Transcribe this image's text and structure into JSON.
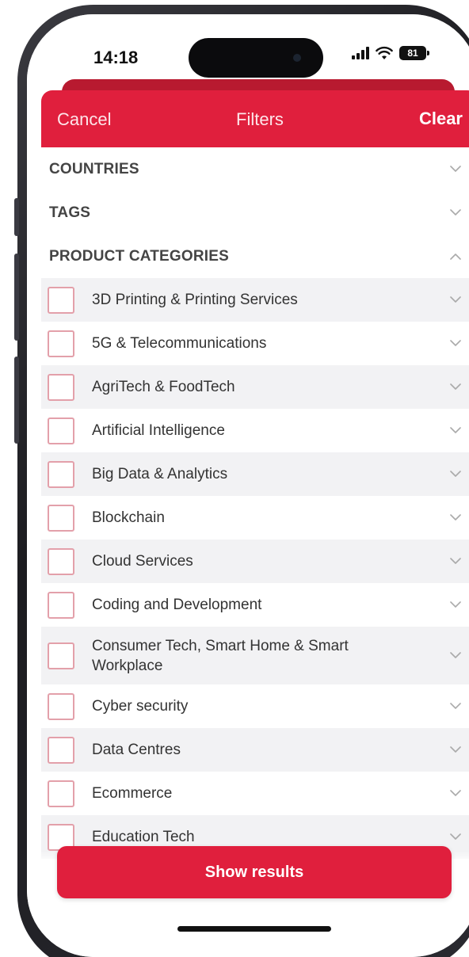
{
  "status_bar": {
    "time": "14:18",
    "battery": "81",
    "icons": [
      "signal-icon",
      "wifi-icon",
      "battery-icon"
    ]
  },
  "header": {
    "cancel_label": "Cancel",
    "title": "Filters",
    "clear_label": "Clear"
  },
  "sections": [
    {
      "label": "COUNTRIES",
      "expanded": false
    },
    {
      "label": "TAGS",
      "expanded": false
    },
    {
      "label": "PRODUCT CATEGORIES",
      "expanded": true
    }
  ],
  "categories": [
    {
      "label": "3D Printing & Printing Services",
      "checked": false
    },
    {
      "label": "5G & Telecommunications",
      "checked": false
    },
    {
      "label": "AgriTech & FoodTech",
      "checked": false
    },
    {
      "label": "Artificial Intelligence",
      "checked": false
    },
    {
      "label": "Big Data & Analytics",
      "checked": false
    },
    {
      "label": "Blockchain",
      "checked": false
    },
    {
      "label": "Cloud Services",
      "checked": false
    },
    {
      "label": "Coding and Development",
      "checked": false
    },
    {
      "label": "Consumer Tech, Smart Home & Smart Workplace",
      "checked": false
    },
    {
      "label": "Cyber security",
      "checked": false
    },
    {
      "label": "Data Centres",
      "checked": false
    },
    {
      "label": "Ecommerce",
      "checked": false
    },
    {
      "label": "Education Tech",
      "checked": false
    }
  ],
  "footer": {
    "show_results_label": "Show results"
  },
  "colors": {
    "accent": "#e01f3d",
    "row_shade": "#f2f2f4",
    "checkbox_border": "#e3a0aa"
  }
}
